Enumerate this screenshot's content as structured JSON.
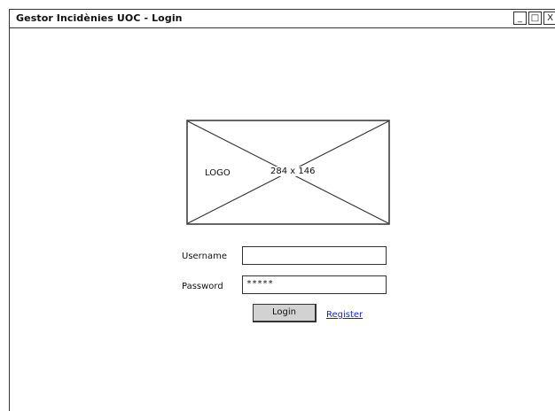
{
  "window": {
    "title": "Gestor Incidènies UOC - Login",
    "controls": {
      "minimize": "_",
      "maximize": "□",
      "close": "X"
    }
  },
  "logo": {
    "text": "LOGO",
    "dimensions": "284 x 146"
  },
  "form": {
    "username_label": "Username",
    "username_value": "",
    "password_label": "Password",
    "password_value": "*****"
  },
  "actions": {
    "login_label": "Login",
    "register_label": "Register"
  },
  "colors": {
    "link": "#1a1aff",
    "button_background": "#d2d2d2",
    "border": "#333333"
  }
}
